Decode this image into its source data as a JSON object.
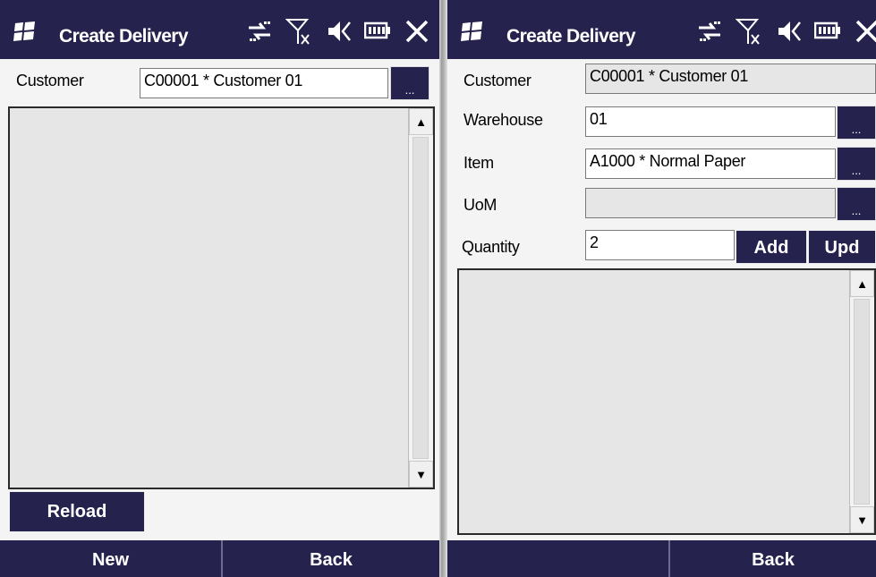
{
  "left_screen": {
    "title": "Create Delivery",
    "customer_label": "Customer",
    "customer_value": "C00001 * Customer 01",
    "lookup_label": "...",
    "reload_label": "Reload",
    "softkey_left": "New",
    "softkey_right": "Back"
  },
  "right_screen": {
    "title": "Create Delivery",
    "customer_label": "Customer",
    "customer_value": "C00001 * Customer 01",
    "warehouse_label": "Warehouse",
    "warehouse_value": "01",
    "item_label": "Item",
    "item_value": "A1000 * Normal Paper",
    "uom_label": "UoM",
    "uom_value": "",
    "quantity_label": "Quantity",
    "quantity_value": "2",
    "lookup_label": "...",
    "add_label": "Add",
    "update_label": "Upd",
    "softkey_left": "",
    "softkey_right": "Back"
  },
  "icons": [
    "windows-start-icon",
    "connectivity-icon",
    "no-signal-icon",
    "volume-muted-icon",
    "battery-icon",
    "close-icon"
  ],
  "colors": {
    "titlebar": "#26224e",
    "disabled_field": "#e6e6e6",
    "background": "#f4f4f4"
  }
}
